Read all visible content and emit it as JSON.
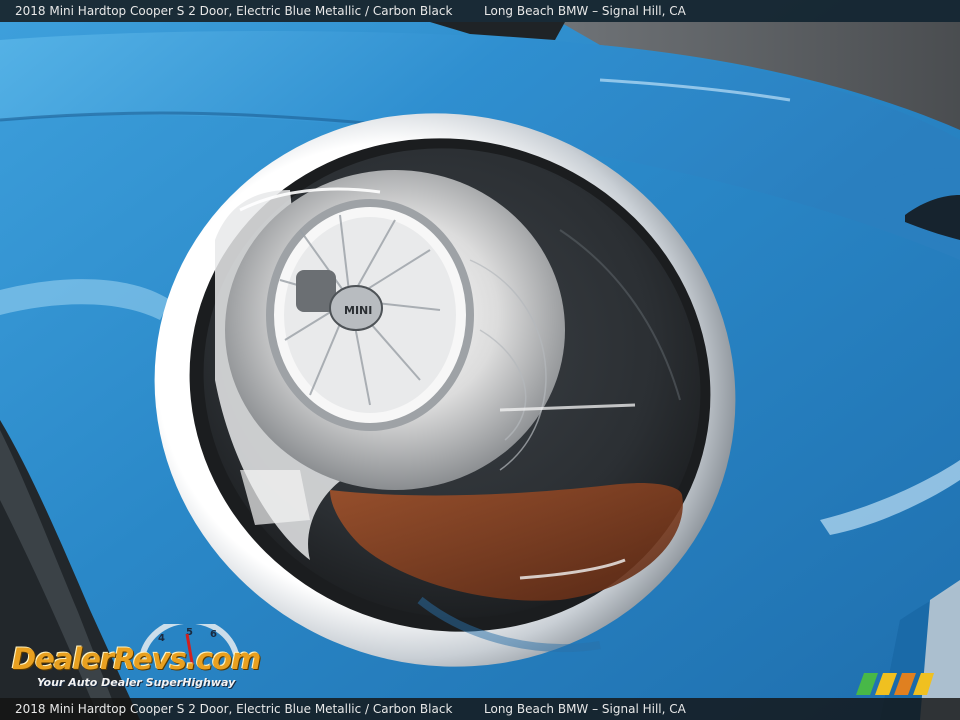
{
  "caption": {
    "vehicle": "2018 Mini Hardtop Cooper S 2 Door,  Electric Blue Metallic / Carbon Black",
    "dealer": "Long Beach BMW – Signal Hill, CA"
  },
  "watermark": {
    "logo_text": "DealerRevs.com",
    "tagline": "Your Auto Dealer SuperHighway",
    "gauge_numbers": [
      "4",
      "5",
      "6"
    ]
  },
  "badge": {
    "text": "MINI"
  },
  "colors": {
    "paint": "#2a88c8",
    "paint_highlight": "#7cc6f0",
    "chrome": "#d8dde2",
    "lens_dark": "#26292c",
    "amber": "#8a4020",
    "logo_orange": "#e8a020"
  }
}
